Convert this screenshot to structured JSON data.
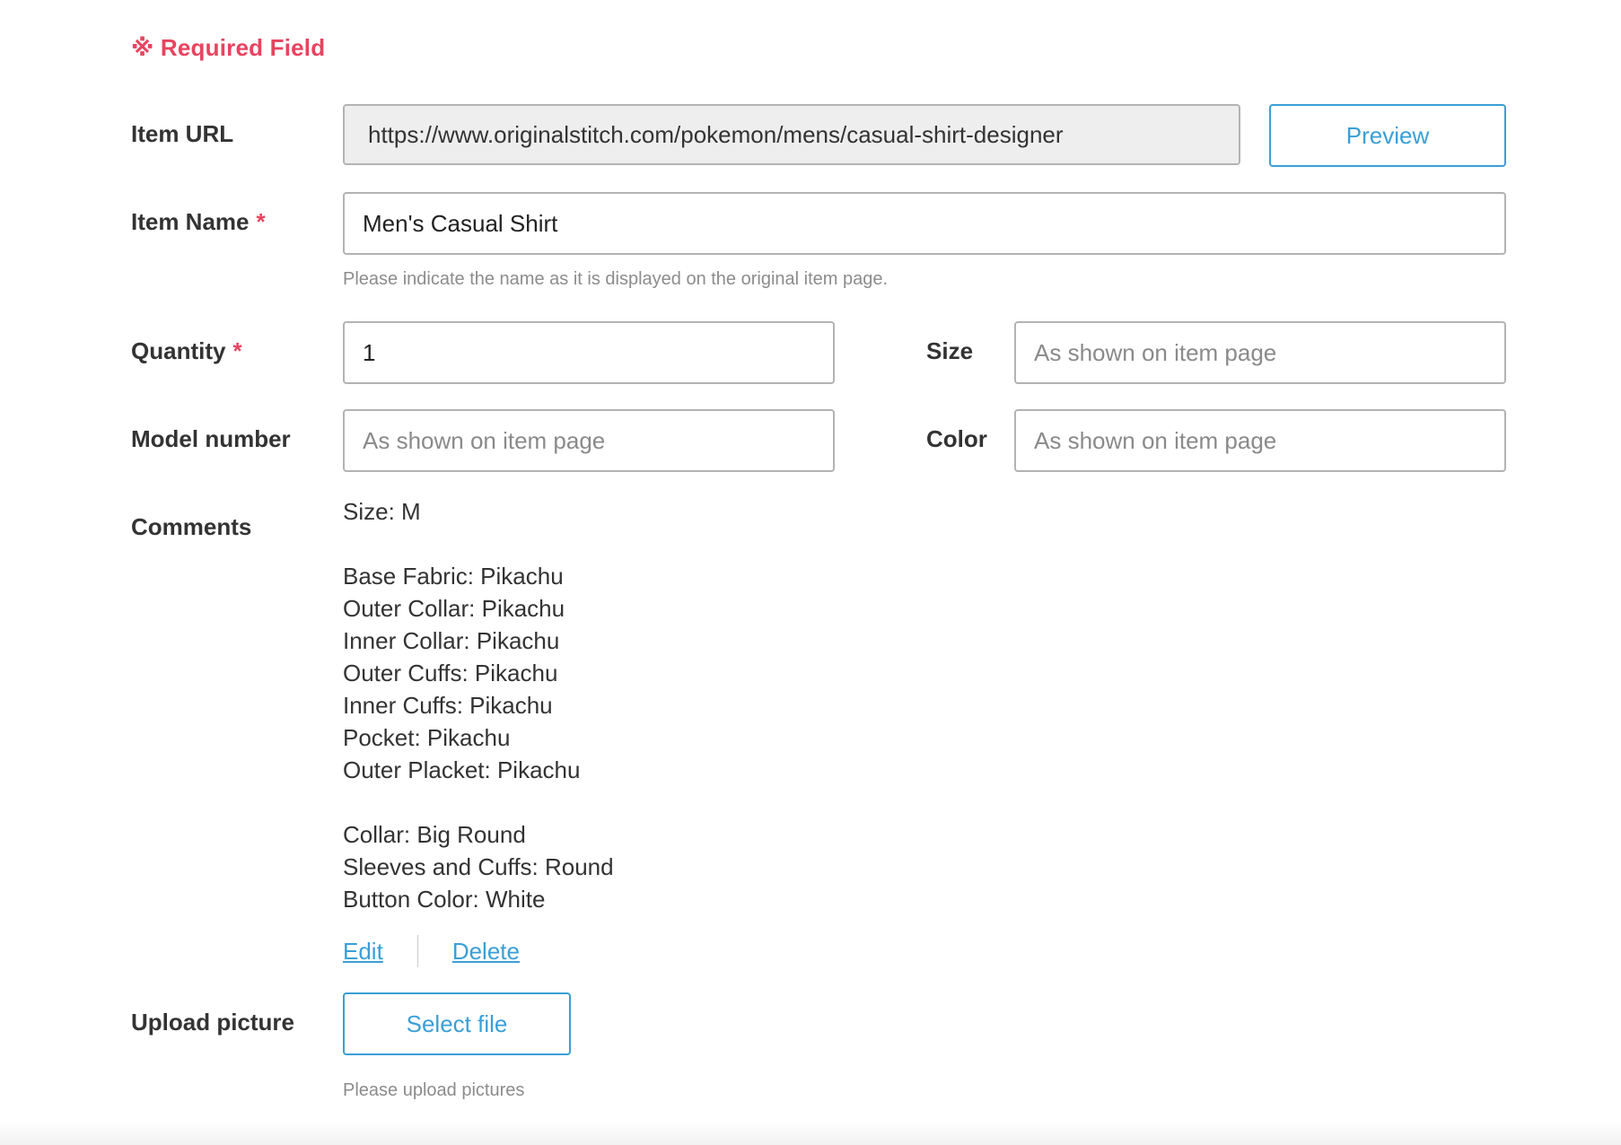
{
  "required_note": "※ Required Field",
  "item_url": {
    "label": "Item URL",
    "value": "https://www.originalstitch.com/pokemon/mens/casual-shirt-designer",
    "preview_button": "Preview"
  },
  "item_name": {
    "label": "Item Name",
    "required_mark": "*",
    "value": "Men's Casual Shirt",
    "help": "Please indicate the name as it is displayed on the original item page."
  },
  "quantity": {
    "label": "Quantity",
    "required_mark": "*",
    "value": "1"
  },
  "size": {
    "label": "Size",
    "placeholder": "As shown on item page",
    "value": ""
  },
  "model_number": {
    "label": "Model number",
    "placeholder": "As shown on item page",
    "value": ""
  },
  "color": {
    "label": "Color",
    "placeholder": "As shown on item page",
    "value": ""
  },
  "comments": {
    "label": "Comments",
    "lines": [
      "Size: M",
      "",
      "Base Fabric: Pikachu",
      "Outer Collar: Pikachu",
      "Inner Collar: Pikachu",
      "Outer Cuffs: Pikachu",
      "Inner Cuffs: Pikachu",
      "Pocket: Pikachu",
      "Outer Placket: Pikachu",
      "",
      "Collar: Big Round",
      "Sleeves and Cuffs: Round",
      "Button Color: White"
    ],
    "edit_link": "Edit",
    "delete_link": "Delete"
  },
  "upload": {
    "label": "Upload picture",
    "button": "Select file",
    "help": "Please upload pictures"
  },
  "colors": {
    "accent": "#3a9fd6",
    "required": "#e8435f",
    "readonly_bg": "#eeeeee"
  }
}
